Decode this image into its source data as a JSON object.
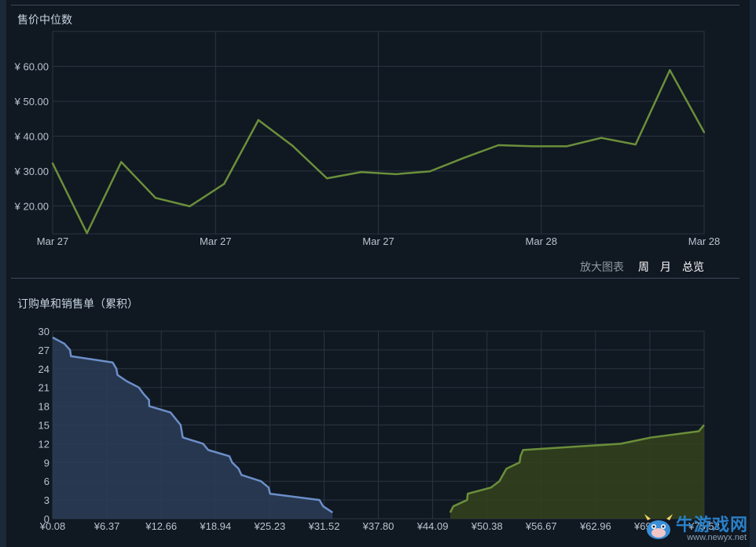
{
  "chart_data": [
    {
      "type": "line",
      "title": "售价中位数",
      "x_tick_labels": [
        "Mar 27",
        "Mar 27",
        "Mar 27",
        "Mar 28",
        "Mar 28"
      ],
      "y_tick_labels": [
        "¥ 20.00",
        "¥ 30.00",
        "¥ 40.00",
        "¥ 50.00",
        "¥ 60.00"
      ],
      "ylim": [
        12,
        70
      ],
      "grid": true,
      "series": [
        {
          "color": "#6b8f3a",
          "values": [
            32.2,
            12.2,
            32.6,
            22.3,
            19.9,
            26.3,
            44.6,
            37.2,
            27.9,
            29.7,
            29.1,
            29.9,
            33.8,
            37.4,
            37.1,
            37.1,
            39.5,
            37.6,
            58.9,
            41.1
          ]
        }
      ]
    },
    {
      "type": "area",
      "title": "订购单和销售单（累积）",
      "x_tick_labels": [
        "¥0.08",
        "¥6.37",
        "¥12.66",
        "¥18.94",
        "¥25.23",
        "¥31.52",
        "¥37.80",
        "¥44.09",
        "¥50.38",
        "¥56.67",
        "¥62.96",
        "¥69.24",
        "¥75.53"
      ],
      "y_tick_labels": [
        "0",
        "3",
        "6",
        "9",
        "12",
        "15",
        "18",
        "21",
        "24",
        "27",
        "30"
      ],
      "xlim": [
        0.08,
        75.53
      ],
      "ylim": [
        0,
        30
      ],
      "grid": true,
      "series": [
        {
          "color": "#6c8fc9",
          "fill": "#2c3d57",
          "points": [
            [
              0.08,
              29
            ],
            [
              1.44,
              28
            ],
            [
              2.09,
              27
            ],
            [
              2.2,
              26
            ],
            [
              7.03,
              25
            ],
            [
              7.46,
              24
            ],
            [
              7.59,
              23
            ],
            [
              8.66,
              22
            ],
            [
              10.06,
              21
            ],
            [
              10.59,
              20
            ],
            [
              11.24,
              19
            ],
            [
              11.27,
              18
            ],
            [
              13.73,
              17
            ],
            [
              14.9,
              15
            ],
            [
              15.15,
              13
            ],
            [
              17.5,
              12
            ],
            [
              18.1,
              11
            ],
            [
              20.55,
              10
            ],
            [
              20.87,
              9
            ],
            [
              21.61,
              8
            ],
            [
              21.95,
              7
            ],
            [
              24.21,
              6
            ],
            [
              25.09,
              5
            ],
            [
              25.26,
              4
            ],
            [
              30.98,
              3
            ],
            [
              31.4,
              2
            ],
            [
              32.5,
              1
            ]
          ]
        },
        {
          "color": "#6b8f3a",
          "fill": "#34431c",
          "points": [
            [
              46.12,
              1
            ],
            [
              46.49,
              2
            ],
            [
              48.08,
              3
            ],
            [
              48.15,
              4
            ],
            [
              50.86,
              5
            ],
            [
              51.81,
              6
            ],
            [
              52.63,
              8
            ],
            [
              54.16,
              9
            ],
            [
              54.26,
              10
            ],
            [
              54.56,
              11
            ],
            [
              65.9,
              12
            ],
            [
              69.39,
              13
            ],
            [
              74.91,
              14
            ],
            [
              75.53,
              15
            ]
          ]
        }
      ]
    }
  ],
  "zoom_controls": {
    "label": "放大图表",
    "week": "周",
    "month": "月",
    "overview": "总览"
  },
  "watermark": {
    "name": "牛游戏网",
    "url": "www.newyx.net"
  },
  "colors": {
    "background": "#101822",
    "grid": "#2a3440",
    "axis_text": "#b8c4cf",
    "line_green": "#6b8f3a",
    "line_blue": "#6c8fc9"
  }
}
